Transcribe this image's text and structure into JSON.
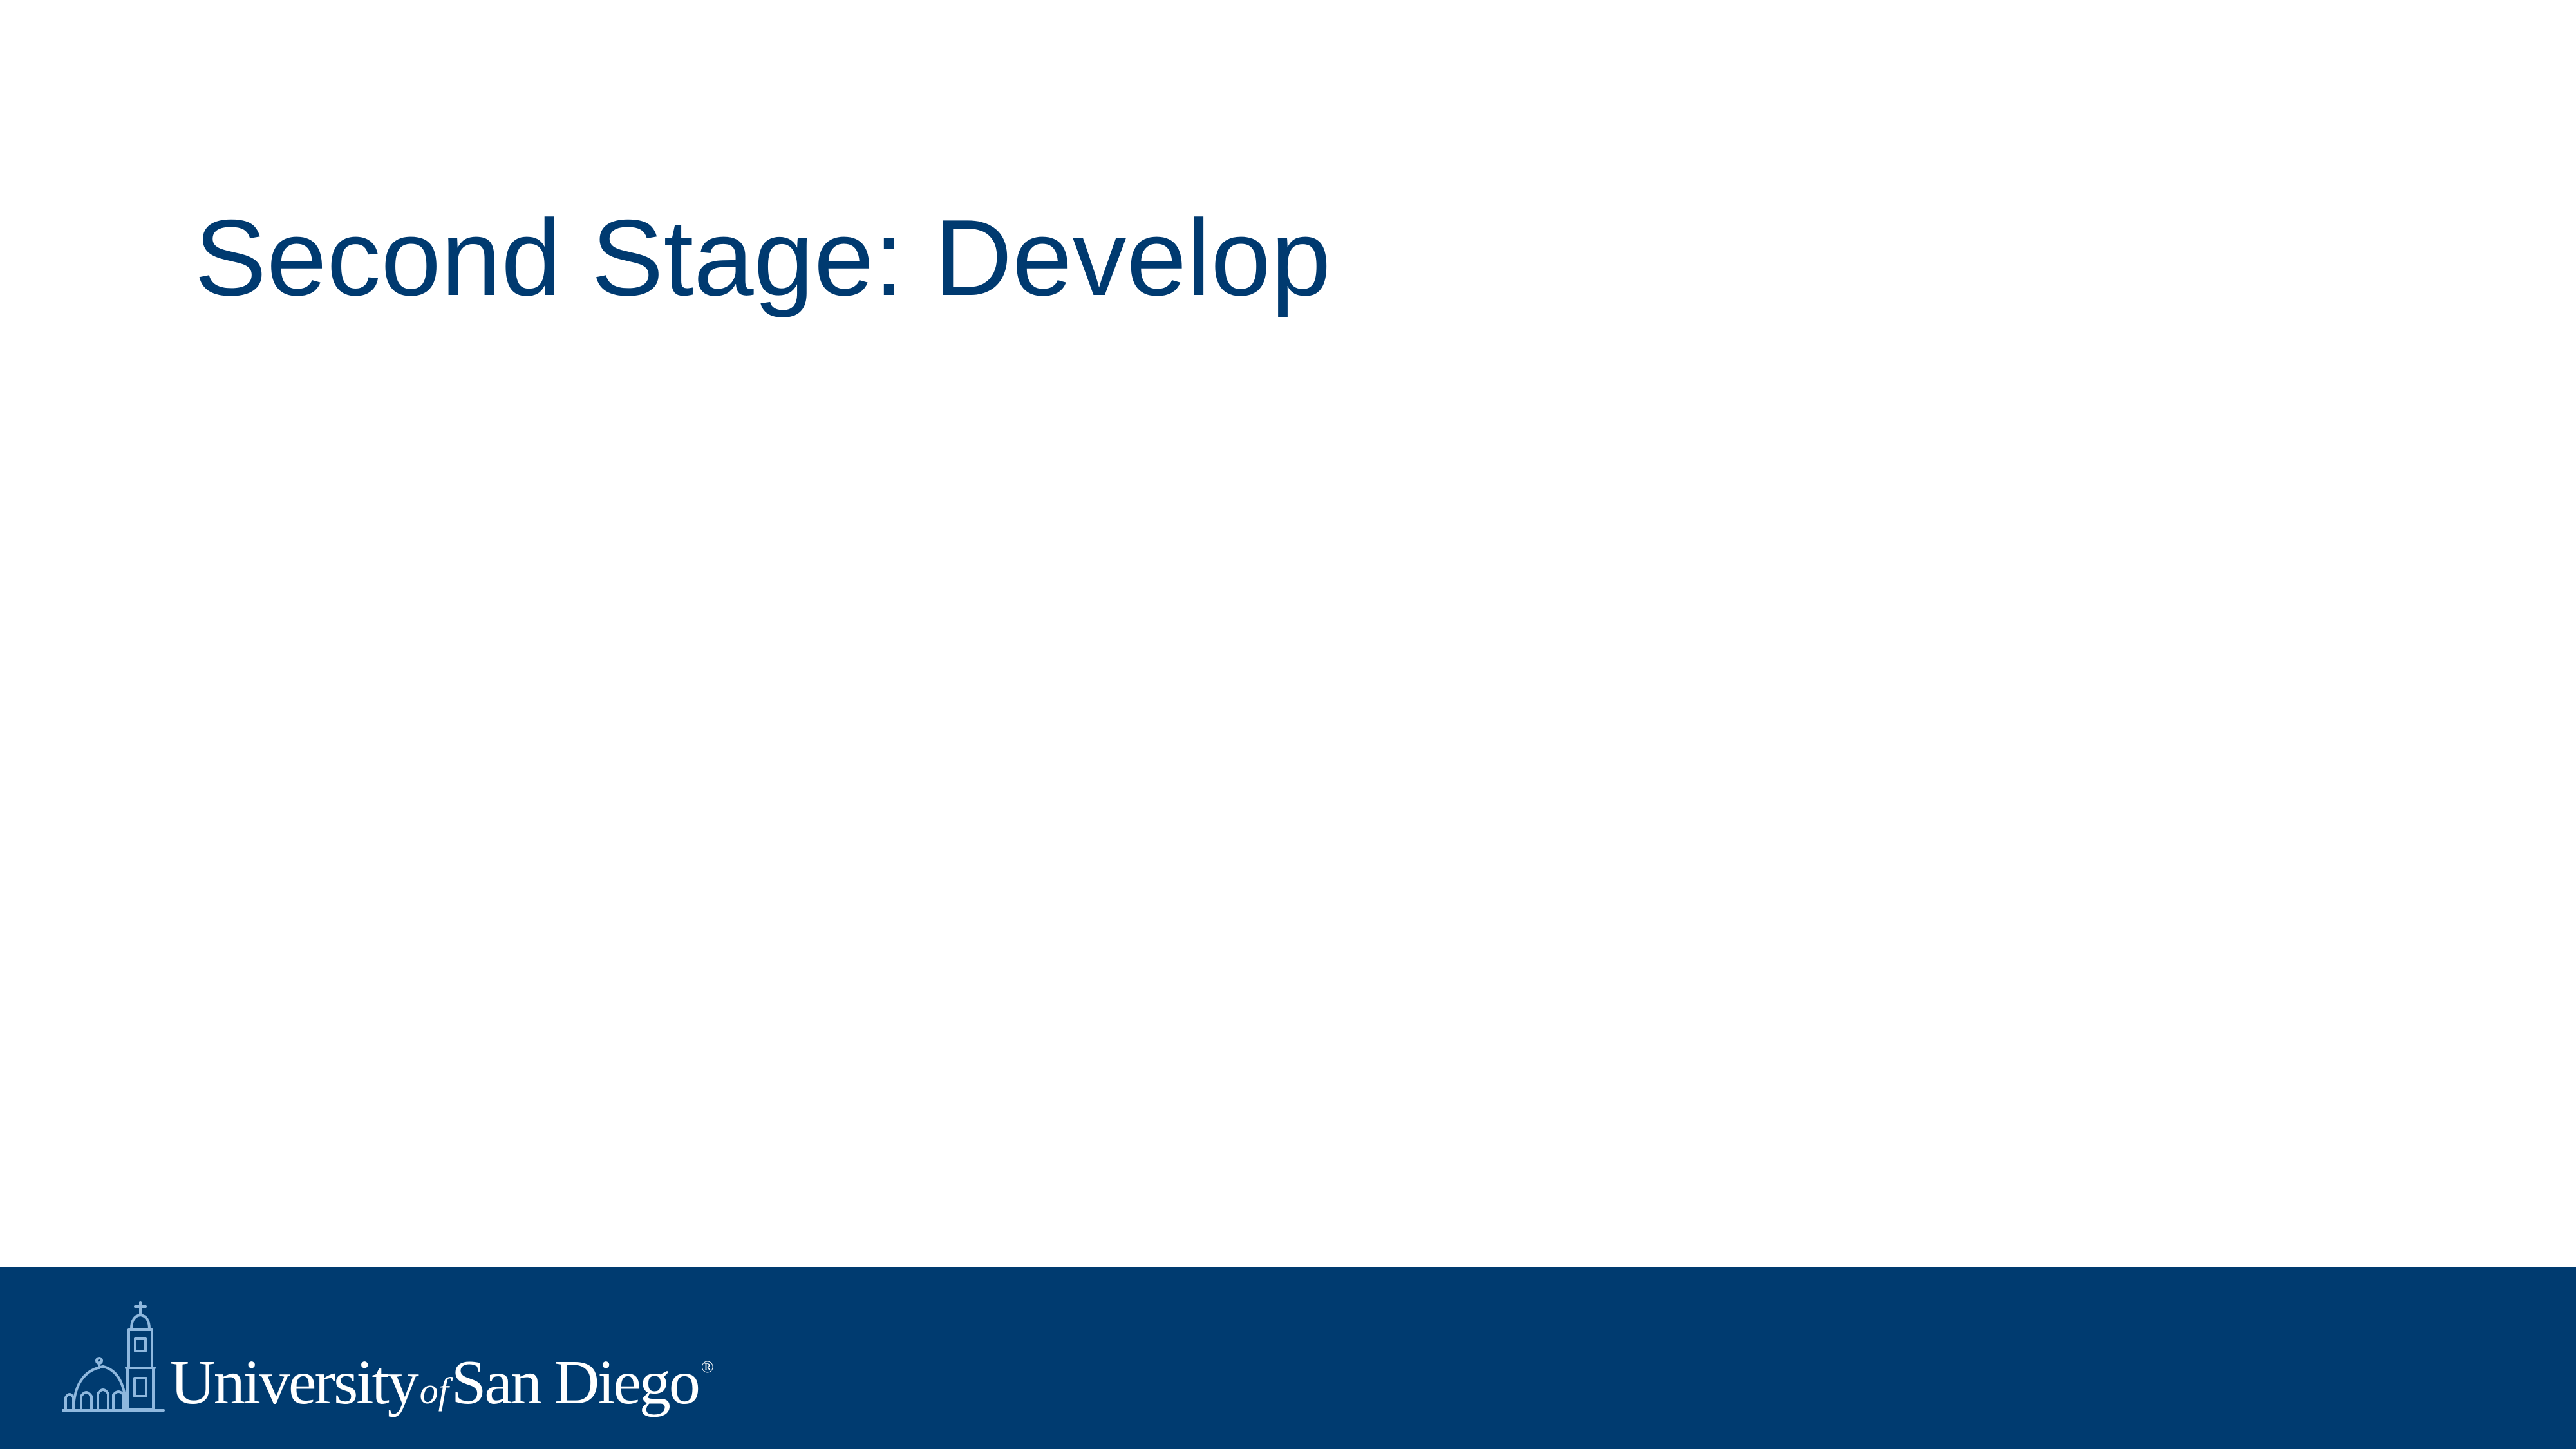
{
  "slide": {
    "title": "Second Stage: Develop"
  },
  "footer": {
    "logo": {
      "icon": "mission-church-icon",
      "wordmark_part1": "University",
      "wordmark_of": "of",
      "wordmark_part2": "San Diego",
      "registered": "®"
    }
  },
  "colors": {
    "title": "#003a70",
    "footer_background": "#003b70",
    "logo_icon": "#8fb8de",
    "logo_text": "#ffffff",
    "slide_background": "#ffffff"
  }
}
